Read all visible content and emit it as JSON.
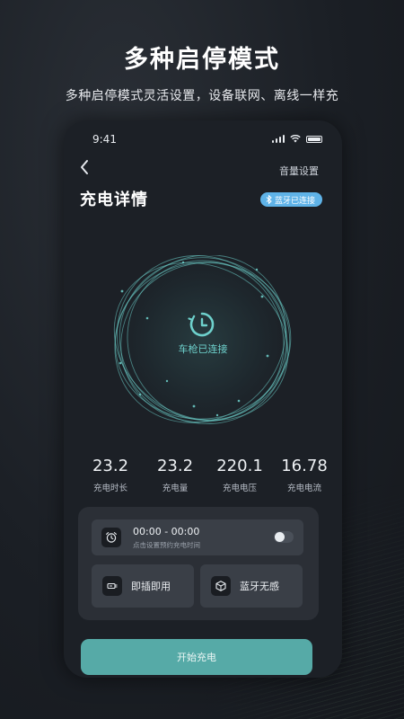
{
  "promo": {
    "headline": "多种启停模式",
    "subline": "多种启停模式灵活设置，设备联网、离线一样充"
  },
  "status_bar": {
    "time": "9:41",
    "icons": [
      "signal-icon",
      "wifi-icon",
      "battery-icon"
    ]
  },
  "nav": {
    "back_icon": "chevron-left-icon",
    "volume_label": "音量设置"
  },
  "page": {
    "title": "充电详情",
    "bluetooth_badge": "蓝牙已连接",
    "bluetooth_icon": "bluetooth-icon"
  },
  "charger": {
    "status_label": "车枪已连接",
    "icon": "charging-clock-icon"
  },
  "stats": [
    {
      "value": "23.2",
      "label": "充电时长"
    },
    {
      "value": "23.2",
      "label": "充电量"
    },
    {
      "value": "220.1",
      "label": "充电电压"
    },
    {
      "value": "16.78",
      "label": "充电电流"
    }
  ],
  "schedule": {
    "time_range": "00:00 - 00:00",
    "hint": "点击设置预约充电时间",
    "icon": "alarm-clock-icon",
    "enabled": false
  },
  "modes": [
    {
      "label": "即插即用",
      "icon": "plug-icon"
    },
    {
      "label": "蓝牙无感",
      "icon": "cube-icon"
    }
  ],
  "actions": {
    "start_label": "开始充电"
  },
  "colors": {
    "accent": "#56aaa7",
    "ring": "#6ed1cc",
    "badge": "#5fb3e8",
    "background": "#1b1f25",
    "phone": "#1c2026"
  }
}
